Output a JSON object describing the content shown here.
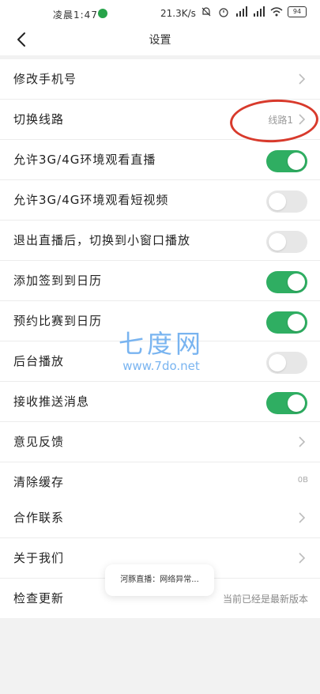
{
  "status_bar": {
    "time": "凌晨1:47",
    "network_speed": "21.3K/s",
    "battery": "94"
  },
  "header": {
    "title": "设置"
  },
  "settings": [
    {
      "label": "修改手机号",
      "type": "link"
    },
    {
      "label": "切换线路",
      "type": "link",
      "value": "线路1"
    },
    {
      "label": "允许3G/4G环境观看直播",
      "type": "toggle",
      "on": true
    },
    {
      "label": "允许3G/4G环境观看短视频",
      "type": "toggle",
      "on": false
    },
    {
      "label": "退出直播后，切换到小窗口播放",
      "type": "toggle",
      "on": false
    },
    {
      "label": "添加签到到日历",
      "type": "toggle",
      "on": true
    },
    {
      "label": "预约比赛到日历",
      "type": "toggle",
      "on": true
    },
    {
      "label": "后台播放",
      "type": "toggle",
      "on": false
    },
    {
      "label": "接收推送消息",
      "type": "toggle",
      "on": true
    },
    {
      "label": "意见反馈",
      "type": "link"
    },
    {
      "label": "清除缓存",
      "type": "value",
      "value": "0B"
    }
  ],
  "about": [
    {
      "label": "合作联系",
      "type": "link"
    },
    {
      "label": "关于我们",
      "type": "link"
    },
    {
      "label": "检查更新",
      "type": "value",
      "value": "当前已经是最新版本"
    }
  ],
  "toast": "河豚直播：网络异常...",
  "watermark": {
    "title": "七度网",
    "url": "www.7do.net"
  },
  "colors": {
    "toggle_on": "#2fae62",
    "toggle_off": "#e7e7e7",
    "annotation": "#d83a2c"
  }
}
